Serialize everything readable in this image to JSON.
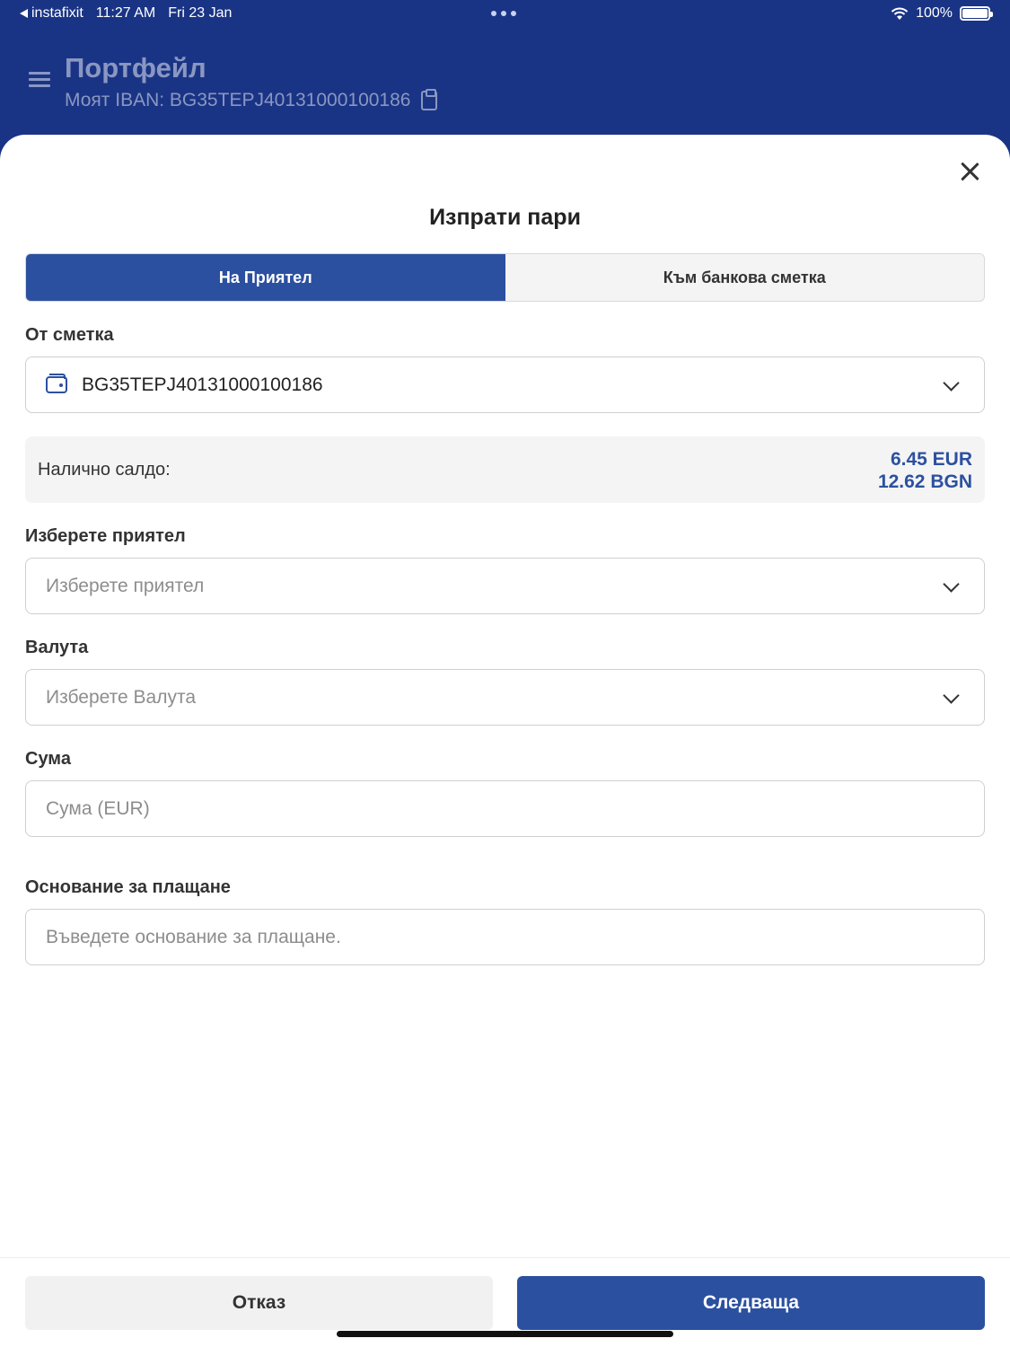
{
  "status_bar": {
    "back_app": "instafixit",
    "time": "11:27 AM",
    "date": "Fri 23 Jan",
    "battery": "100%",
    "battery_level": 1.0
  },
  "header": {
    "title": "Портфейл",
    "iban": "Моят IBAN: BG35TEPJ40131000100186"
  },
  "sheet": {
    "title": "Изпрати пари",
    "tabs": [
      {
        "label": "На Приятел",
        "active": true
      },
      {
        "label": "Към банкова сметка",
        "active": false
      }
    ],
    "from_account": {
      "label": "От сметка",
      "value": "BG35TEPJ40131000100186"
    },
    "balance": {
      "label": "Налично салдо:",
      "eur": "6.45 EUR",
      "bgn": "12.62 BGN"
    },
    "friend": {
      "label": "Изберете приятел",
      "placeholder": "Изберете приятел"
    },
    "currency": {
      "label": "Валута",
      "placeholder": "Изберете Валута"
    },
    "amount": {
      "label": "Сума",
      "placeholder": "Сума (EUR)"
    },
    "reason": {
      "label": "Основание за плащане",
      "placeholder": "Въведете основание за плащане."
    },
    "buttons": {
      "cancel": "Отказ",
      "next": "Следваща"
    }
  },
  "colors": {
    "header_bg": "#1a3485",
    "accent": "#2c50a0"
  }
}
